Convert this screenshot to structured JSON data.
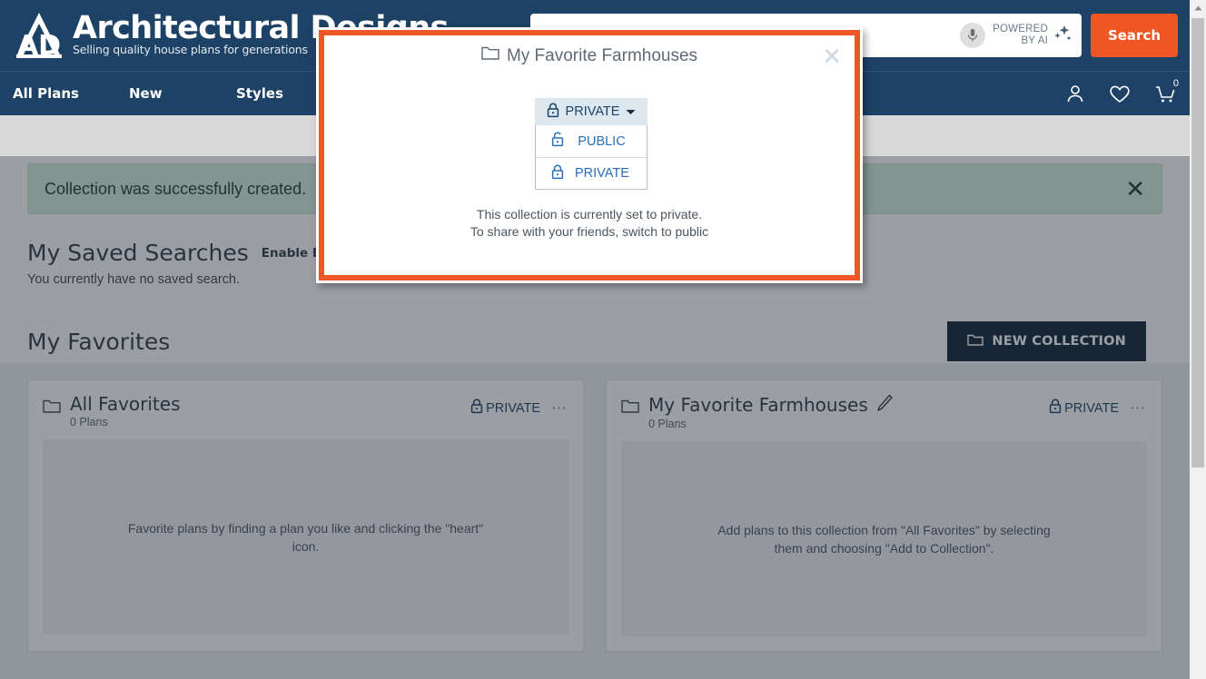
{
  "brand": {
    "title": "Architectural Designs",
    "tagline": "Selling quality house plans for generations",
    "accent_orange": "#ee5725",
    "navy": "#1d4266"
  },
  "search": {
    "value": "",
    "placeholder": "",
    "powered_line1": "POWERED",
    "powered_line2": "BY AI",
    "button_label": "Search",
    "mic_icon": "microphone-icon",
    "sparkle_icon": "sparkle-ai-icon"
  },
  "nav": {
    "links": [
      {
        "label": "All Plans"
      },
      {
        "label": "New"
      },
      {
        "label": "Styles"
      }
    ],
    "truncated_link": "es",
    "icons": [
      {
        "name": "account-icon"
      },
      {
        "name": "wishlist-heart-icon"
      },
      {
        "name": "cart-icon",
        "badge": "0"
      }
    ]
  },
  "alert": {
    "message": "Collection was successfully created.",
    "close_icon": "close-icon"
  },
  "saved_searches": {
    "heading": "My Saved Searches",
    "enable_emails_label": "Enable Emails",
    "enable_emails_checked": true,
    "empty_text": "You currently have no saved search."
  },
  "favorites": {
    "heading": "My Favorites",
    "new_collection_label": "NEW COLLECTION",
    "new_collection_icon": "folder-icon",
    "cards": [
      {
        "title": "All Favorites",
        "plans_count": "0 Plans",
        "privacy": "PRIVATE",
        "privacy_icon": "lock-closed-icon",
        "menu_icon": "ellipsis-icon",
        "folder_icon": "folder-icon",
        "editable": false,
        "empty_text": "Favorite plans by finding a plan you like and clicking the \"heart\" icon."
      },
      {
        "title": "My Favorite Farmhouses",
        "plans_count": "0 Plans",
        "privacy": "PRIVATE",
        "privacy_icon": "lock-closed-icon",
        "menu_icon": "ellipsis-icon",
        "folder_icon": "folder-icon",
        "editable": true,
        "edit_icon": "pencil-icon",
        "empty_text": "Add plans to this collection from \"All Favorites\" by selecting them and choosing \"Add to Collection\"."
      }
    ]
  },
  "modal": {
    "title": "My Favorite Farmhouses",
    "title_icon": "folder-icon",
    "close_icon": "close-icon",
    "dropdown": {
      "selected": "PRIVATE",
      "selected_icon": "lock-closed-icon",
      "caret_icon": "chevron-down-icon",
      "open": true,
      "options": [
        {
          "label": "PUBLIC",
          "icon": "lock-open-icon"
        },
        {
          "label": "PRIVATE",
          "icon": "lock-closed-icon"
        }
      ]
    },
    "note_line1": "This collection is currently set to private.",
    "note_line2": "To share with your friends, switch to public"
  },
  "scrollbar": {
    "up_arrow_icon": "caret-up-icon"
  }
}
